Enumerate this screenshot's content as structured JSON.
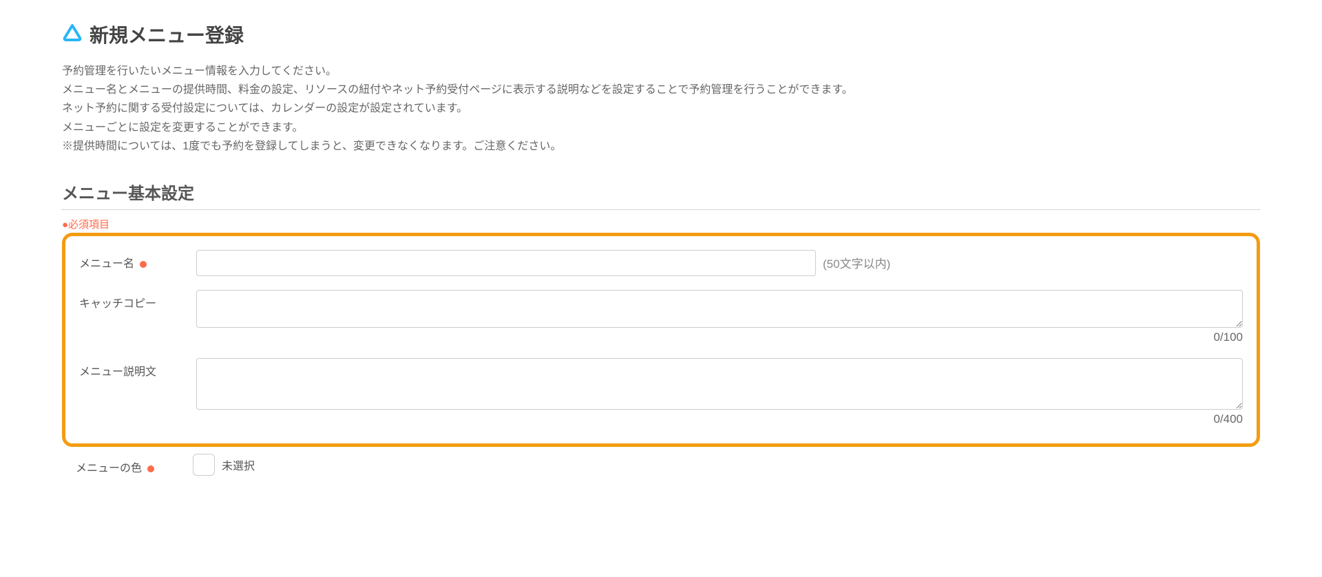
{
  "page": {
    "title": "新規メニュー登録"
  },
  "description": {
    "line1": "予約管理を行いたいメニュー情報を入力してください。",
    "line2": "メニュー名とメニューの提供時間、料金の設定、リソースの紐付やネット予約受付ページに表示する説明などを設定することで予約管理を行うことができます。",
    "line3": "ネット予約に関する受付設定については、カレンダーの設定が設定されています。",
    "line4": "メニューごとに設定を変更することができます。",
    "line5": "※提供時間については、1度でも予約を登録してしまうと、変更できなくなります。ご注意ください。"
  },
  "section": {
    "title": "メニュー基本設定",
    "required_legend": "●必須項目"
  },
  "form": {
    "menu_name": {
      "label": "メニュー名",
      "value": "",
      "hint": "(50文字以内)"
    },
    "catch_copy": {
      "label": "キャッチコピー",
      "value": "",
      "counter": "0/100"
    },
    "description": {
      "label": "メニュー説明文",
      "value": "",
      "counter": "0/400"
    },
    "color": {
      "label": "メニューの色",
      "value_text": "未選択"
    }
  }
}
